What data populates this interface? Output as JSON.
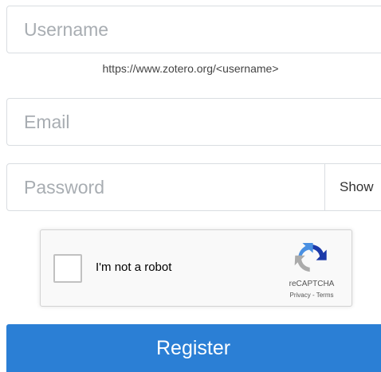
{
  "form": {
    "username": {
      "value": "",
      "placeholder": "Username"
    },
    "username_hint": "https://www.zotero.org/<username>",
    "email": {
      "value": "",
      "placeholder": "Email"
    },
    "password": {
      "value": "",
      "placeholder": "Password",
      "show_label": "Show"
    },
    "register_label": "Register"
  },
  "recaptcha": {
    "checkbox_label": "I'm not a robot",
    "brand": "reCAPTCHA",
    "privacy_label": "Privacy",
    "separator": " - ",
    "terms_label": "Terms",
    "logo_icon": "recaptcha-logo-icon"
  },
  "colors": {
    "primary": "#2b7fd5",
    "border": "#d9dde1",
    "placeholder": "#a8adb2",
    "recaptcha_blue_dark": "#1c3aa9",
    "recaptcha_blue": "#4a90e2",
    "recaptcha_gray": "#ababab"
  }
}
